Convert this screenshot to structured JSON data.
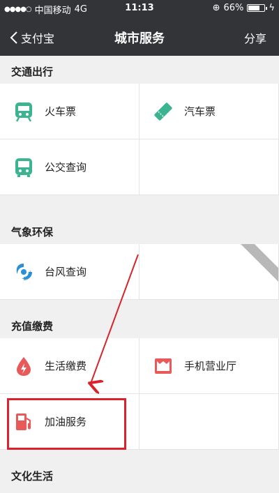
{
  "status": {
    "carrier": "中国移动",
    "network": "4G",
    "time": "11:13",
    "battery": "66%",
    "battery_level": 0.66
  },
  "nav": {
    "back_label": "支付宝",
    "title": "城市服务",
    "share_label": "分享"
  },
  "sections": [
    {
      "title": "交通出行",
      "items": [
        {
          "label": "火车票",
          "icon": "train-icon",
          "color": "#3cb492"
        },
        {
          "label": "汽车票",
          "icon": "ticket-icon",
          "color": "#3cb492"
        },
        {
          "label": "公交查询",
          "icon": "bus-icon",
          "color": "#3cb492"
        }
      ]
    },
    {
      "title": "气象环保",
      "items": [
        {
          "label": "台风查询",
          "icon": "typhoon-icon",
          "color": "#2a8fd6"
        }
      ]
    },
    {
      "title": "充值缴费",
      "items": [
        {
          "label": "生活缴费",
          "icon": "utility-drop-icon",
          "color": "#e85a5a"
        },
        {
          "label": "手机营业厅",
          "icon": "mobile-store-icon",
          "color": "#e85a5a"
        },
        {
          "label": "加油服务",
          "icon": "fuel-pump-icon",
          "color": "#e85a5a"
        }
      ]
    },
    {
      "title": "文化生活"
    }
  ]
}
